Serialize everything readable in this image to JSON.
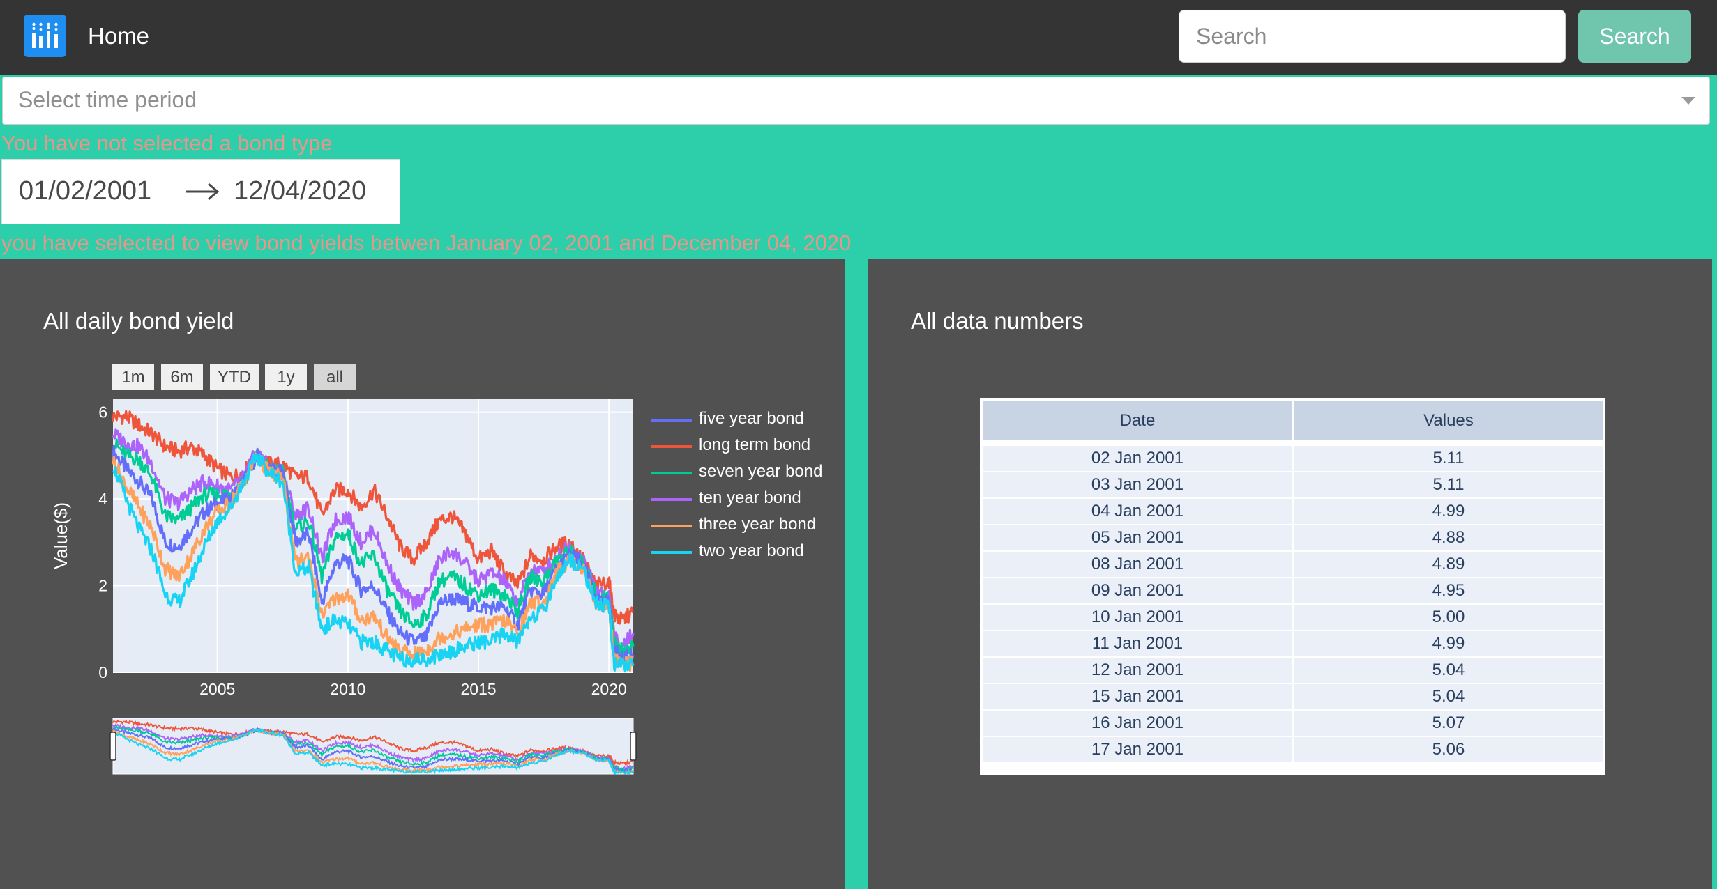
{
  "navbar": {
    "brand": "Home",
    "search_placeholder": "Search",
    "search_button": "Search"
  },
  "filters": {
    "dropdown_placeholder": "Select time period",
    "bond_type_message": "You have not selected a bond type",
    "start_date": "01/02/2001",
    "end_date": "12/04/2020",
    "range_message": "you have selected to view bond yields betwen January 02, 2001 and December 04, 2020"
  },
  "chart_panel": {
    "title": "All daily bond yield",
    "range_buttons": [
      {
        "label": "1m",
        "active": false
      },
      {
        "label": "6m",
        "active": false
      },
      {
        "label": "YTD",
        "active": false
      },
      {
        "label": "1y",
        "active": false
      },
      {
        "label": "all",
        "active": true
      }
    ]
  },
  "chart_data": {
    "type": "line",
    "title": "All daily bond yield",
    "xlabel": "",
    "ylabel": "Value($)",
    "xlim": [
      2001.0,
      2020.93
    ],
    "ylim": [
      0,
      6.3
    ],
    "x_ticks": [
      2005,
      2010,
      2015,
      2020
    ],
    "y_ticks": [
      0,
      2,
      4,
      6
    ],
    "grid": true,
    "legend": "right",
    "rangeslider": true,
    "series": [
      {
        "name": "five year bond",
        "color": "#636efa",
        "x": [
          2001.0,
          2001.5,
          2002.0,
          2002.5,
          2003.0,
          2003.5,
          2004.0,
          2004.5,
          2005.0,
          2005.5,
          2006.0,
          2006.5,
          2007.0,
          2007.5,
          2008.0,
          2008.5,
          2009.0,
          2009.5,
          2010.0,
          2010.5,
          2011.0,
          2011.5,
          2012.0,
          2012.5,
          2013.0,
          2013.5,
          2014.0,
          2014.5,
          2015.0,
          2015.5,
          2016.0,
          2016.5,
          2017.0,
          2017.5,
          2018.0,
          2018.5,
          2019.0,
          2019.5,
          2020.0,
          2020.2,
          2020.5,
          2020.93
        ],
        "y": [
          5.1,
          4.7,
          4.4,
          4.0,
          3.0,
          2.9,
          3.3,
          3.7,
          3.9,
          4.0,
          4.4,
          5.0,
          4.7,
          4.6,
          3.0,
          3.2,
          1.6,
          2.5,
          2.6,
          1.9,
          2.0,
          1.4,
          0.9,
          0.7,
          0.8,
          1.6,
          1.7,
          1.6,
          1.5,
          1.5,
          1.5,
          1.1,
          1.9,
          1.8,
          2.4,
          2.7,
          2.5,
          1.7,
          1.6,
          0.5,
          0.3,
          0.4
        ]
      },
      {
        "name": "long term bond",
        "color": "#ef553b",
        "x": [
          2001.0,
          2001.5,
          2002.0,
          2002.5,
          2003.0,
          2003.5,
          2004.0,
          2004.5,
          2005.0,
          2005.5,
          2006.0,
          2006.5,
          2007.0,
          2007.5,
          2008.0,
          2008.5,
          2009.0,
          2009.5,
          2010.0,
          2010.5,
          2011.0,
          2011.5,
          2012.0,
          2012.5,
          2013.0,
          2013.5,
          2014.0,
          2014.5,
          2015.0,
          2015.5,
          2016.0,
          2016.5,
          2017.0,
          2017.5,
          2018.0,
          2018.5,
          2019.0,
          2019.5,
          2020.0,
          2020.2,
          2020.5,
          2020.93
        ],
        "y": [
          5.9,
          5.9,
          5.7,
          5.5,
          5.2,
          5.1,
          5.2,
          5.0,
          4.7,
          4.5,
          4.6,
          5.0,
          4.8,
          4.8,
          4.5,
          4.5,
          3.6,
          4.2,
          4.2,
          3.8,
          4.2,
          3.6,
          2.9,
          2.6,
          3.0,
          3.5,
          3.6,
          3.2,
          2.6,
          2.8,
          2.3,
          2.0,
          2.7,
          2.6,
          2.9,
          3.0,
          2.6,
          2.0,
          2.1,
          1.3,
          1.2,
          1.4
        ]
      },
      {
        "name": "seven year bond",
        "color": "#00cc96",
        "x": [
          2001.0,
          2001.5,
          2002.0,
          2002.5,
          2003.0,
          2003.5,
          2004.0,
          2004.5,
          2005.0,
          2005.5,
          2006.0,
          2006.5,
          2007.0,
          2007.5,
          2008.0,
          2008.5,
          2009.0,
          2009.5,
          2010.0,
          2010.5,
          2011.0,
          2011.5,
          2012.0,
          2012.5,
          2013.0,
          2013.5,
          2014.0,
          2014.5,
          2015.0,
          2015.5,
          2016.0,
          2016.5,
          2017.0,
          2017.5,
          2018.0,
          2018.5,
          2019.0,
          2019.5,
          2020.0,
          2020.2,
          2020.5,
          2020.93
        ],
        "y": [
          5.3,
          5.0,
          4.9,
          4.5,
          3.6,
          3.5,
          3.8,
          4.1,
          4.1,
          4.1,
          4.4,
          5.0,
          4.7,
          4.6,
          3.3,
          3.5,
          2.2,
          3.1,
          3.2,
          2.5,
          2.7,
          1.9,
          1.4,
          1.1,
          1.3,
          2.1,
          2.2,
          2.0,
          1.8,
          1.9,
          1.8,
          1.4,
          2.2,
          2.1,
          2.6,
          2.8,
          2.5,
          1.8,
          1.7,
          0.7,
          0.5,
          0.6
        ]
      },
      {
        "name": "ten year bond",
        "color": "#ab63fa",
        "x": [
          2001.0,
          2001.5,
          2002.0,
          2002.5,
          2003.0,
          2003.5,
          2004.0,
          2004.5,
          2005.0,
          2005.5,
          2006.0,
          2006.5,
          2007.0,
          2007.5,
          2008.0,
          2008.5,
          2009.0,
          2009.5,
          2010.0,
          2010.5,
          2011.0,
          2011.5,
          2012.0,
          2012.5,
          2013.0,
          2013.5,
          2014.0,
          2014.5,
          2015.0,
          2015.5,
          2016.0,
          2016.5,
          2017.0,
          2017.5,
          2018.0,
          2018.5,
          2019.0,
          2019.5,
          2020.0,
          2020.2,
          2020.5,
          2020.93
        ],
        "y": [
          5.5,
          5.3,
          5.2,
          4.8,
          4.0,
          3.9,
          4.2,
          4.4,
          4.3,
          4.2,
          4.5,
          5.1,
          4.7,
          4.6,
          3.6,
          3.8,
          2.6,
          3.5,
          3.6,
          3.0,
          3.3,
          2.5,
          1.9,
          1.6,
          1.8,
          2.6,
          2.8,
          2.5,
          2.1,
          2.3,
          2.1,
          1.6,
          2.4,
          2.3,
          2.7,
          2.9,
          2.6,
          1.9,
          1.8,
          0.8,
          0.6,
          0.9
        ]
      },
      {
        "name": "three year bond",
        "color": "#ffa15a",
        "x": [
          2001.0,
          2001.5,
          2002.0,
          2002.5,
          2003.0,
          2003.5,
          2004.0,
          2004.5,
          2005.0,
          2005.5,
          2006.0,
          2006.5,
          2007.0,
          2007.5,
          2008.0,
          2008.5,
          2009.0,
          2009.5,
          2010.0,
          2010.5,
          2011.0,
          2011.5,
          2012.0,
          2012.5,
          2013.0,
          2013.5,
          2014.0,
          2014.5,
          2015.0,
          2015.5,
          2016.0,
          2016.5,
          2017.0,
          2017.5,
          2018.0,
          2018.5,
          2019.0,
          2019.5,
          2020.0,
          2020.2,
          2020.5,
          2020.93
        ],
        "y": [
          4.9,
          4.3,
          3.8,
          3.3,
          2.4,
          2.2,
          2.7,
          3.3,
          3.7,
          3.9,
          4.4,
          5.0,
          4.6,
          4.5,
          2.5,
          2.7,
          1.3,
          1.7,
          1.8,
          1.2,
          1.3,
          0.8,
          0.5,
          0.4,
          0.5,
          0.8,
          0.9,
          1.0,
          1.1,
          1.1,
          1.2,
          0.9,
          1.6,
          1.6,
          2.3,
          2.6,
          2.4,
          1.6,
          1.5,
          0.3,
          0.2,
          0.2
        ]
      },
      {
        "name": "two year bond",
        "color": "#19d3f3",
        "x": [
          2001.0,
          2001.5,
          2002.0,
          2002.5,
          2003.0,
          2003.5,
          2004.0,
          2004.5,
          2005.0,
          2005.5,
          2006.0,
          2006.5,
          2007.0,
          2007.5,
          2008.0,
          2008.5,
          2009.0,
          2009.5,
          2010.0,
          2010.5,
          2011.0,
          2011.5,
          2012.0,
          2012.5,
          2013.0,
          2013.5,
          2014.0,
          2014.5,
          2015.0,
          2015.5,
          2016.0,
          2016.5,
          2017.0,
          2017.5,
          2018.0,
          2018.5,
          2019.0,
          2019.5,
          2020.0,
          2020.2,
          2020.5,
          2020.93
        ],
        "y": [
          4.8,
          4.0,
          3.3,
          2.8,
          1.8,
          1.6,
          2.2,
          2.9,
          3.5,
          3.8,
          4.4,
          5.0,
          4.6,
          4.4,
          2.3,
          2.4,
          1.0,
          1.2,
          1.1,
          0.7,
          0.7,
          0.5,
          0.3,
          0.3,
          0.3,
          0.4,
          0.5,
          0.6,
          0.7,
          0.7,
          0.9,
          0.7,
          1.3,
          1.4,
          2.2,
          2.6,
          2.4,
          1.6,
          1.5,
          0.2,
          0.15,
          0.15
        ]
      }
    ]
  },
  "table_panel": {
    "title": "All data numbers",
    "columns": [
      "Date",
      "Values"
    ],
    "rows": [
      [
        "02 Jan 2001",
        "5.11"
      ],
      [
        "03 Jan 2001",
        "5.11"
      ],
      [
        "04 Jan 2001",
        "4.99"
      ],
      [
        "05 Jan 2001",
        "4.88"
      ],
      [
        "08 Jan 2001",
        "4.89"
      ],
      [
        "09 Jan 2001",
        "4.95"
      ],
      [
        "10 Jan 2001",
        "5.00"
      ],
      [
        "11 Jan 2001",
        "4.99"
      ],
      [
        "12 Jan 2001",
        "5.04"
      ],
      [
        "15 Jan 2001",
        "5.04"
      ],
      [
        "16 Jan 2001",
        "5.07"
      ],
      [
        "17 Jan 2001",
        "5.06"
      ]
    ]
  }
}
